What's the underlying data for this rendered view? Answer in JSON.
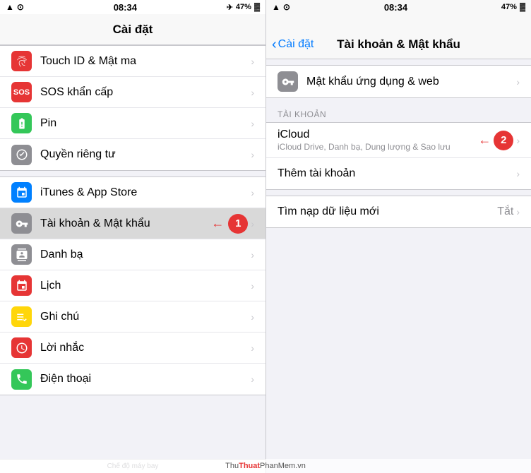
{
  "left": {
    "statusBar": {
      "signal": "●●●●",
      "wifi": "wifi",
      "time": "08:34",
      "airplane": "✈",
      "battery": "47%"
    },
    "navTitle": "Cài đặt",
    "items": [
      {
        "id": "touch-id",
        "label": "Touch ID & Mật ma",
        "iconColor": "icon-red",
        "iconType": "fingerprint"
      },
      {
        "id": "sos",
        "label": "SOS khẩn cấp",
        "iconColor": "icon-red",
        "iconType": "sos"
      },
      {
        "id": "pin",
        "label": "Pin",
        "iconColor": "icon-green",
        "iconType": "battery"
      },
      {
        "id": "privacy",
        "label": "Quyền riêng tư",
        "iconColor": "icon-gray",
        "iconType": "hand"
      },
      {
        "id": "itunes",
        "label": "iTunes & App Store",
        "iconColor": "icon-apps",
        "iconType": "apps"
      },
      {
        "id": "accounts",
        "label": "Tài khoản & Mật khẩu",
        "iconColor": "icon-gray",
        "iconType": "key",
        "highlighted": true,
        "step": "1"
      },
      {
        "id": "contacts",
        "label": "Danh bạ",
        "iconColor": "icon-gray",
        "iconType": "contacts"
      },
      {
        "id": "calendar",
        "label": "Lịch",
        "iconColor": "icon-red",
        "iconType": "calendar"
      },
      {
        "id": "notes",
        "label": "Ghi chú",
        "iconColor": "icon-yellow",
        "iconType": "notes"
      },
      {
        "id": "reminders",
        "label": "Lời nhắc",
        "iconColor": "icon-red",
        "iconType": "reminders"
      },
      {
        "id": "phone",
        "label": "Điện thoại",
        "iconColor": "icon-green",
        "iconType": "phone"
      }
    ],
    "bottomText": "Chế độ máy bay"
  },
  "right": {
    "statusBar": {
      "time": "08:34",
      "battery": "47%"
    },
    "backLabel": "Cài đặt",
    "navTitle": "Tài khoản & Mật khẩu",
    "passwordItem": {
      "label": "Mật khẩu ứng dụng & web",
      "iconType": "key"
    },
    "sectionHeader": "TÀI KHOẢN",
    "accounts": [
      {
        "id": "icloud",
        "label": "iCloud",
        "sublabel": "iCloud Drive, Danh bạ, Dung lượng & Sao lưu",
        "step": "2"
      },
      {
        "id": "add-account",
        "label": "Thêm tài khoản",
        "sublabel": ""
      }
    ],
    "fetchItem": {
      "label": "Tìm nạp dữ liệu mới",
      "value": "Tắt"
    }
  },
  "watermark": {
    "prefix": "Thu",
    "brand": "Thuat",
    "suffix": "PhanMem.vn"
  }
}
